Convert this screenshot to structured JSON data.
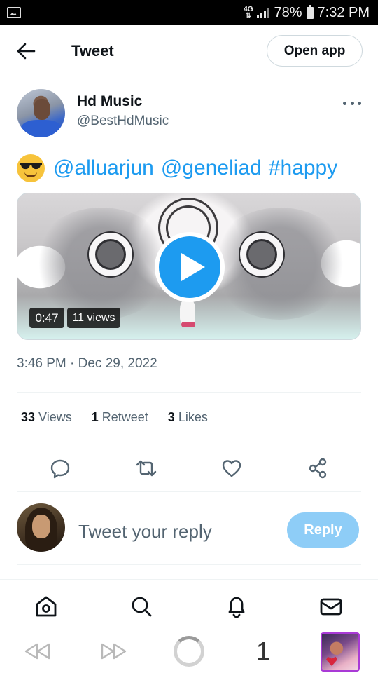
{
  "status_bar": {
    "network": "4G",
    "battery": "78%",
    "time": "7:32 PM"
  },
  "header": {
    "title": "Tweet",
    "open_app_label": "Open app"
  },
  "tweet": {
    "author_name": "Hd Music",
    "author_handle": "@BestHdMusic",
    "emoji": "sunglasses-emoji",
    "mentions": [
      "@alluarjun",
      "@geneliad",
      "#happy"
    ],
    "video": {
      "duration": "0:47",
      "views": "11 views"
    },
    "timestamp": "3:46 PM · Dec 29, 2022"
  },
  "stats": [
    {
      "count": "33",
      "label": "Views"
    },
    {
      "count": "1",
      "label": "Retweet"
    },
    {
      "count": "3",
      "label": "Likes"
    }
  ],
  "actions": [
    "reply-icon",
    "retweet-icon",
    "like-icon",
    "share-icon"
  ],
  "reply": {
    "placeholder": "Tweet your reply",
    "button_label": "Reply"
  },
  "tabbar": [
    "home-icon",
    "search-icon",
    "notifications-icon",
    "messages-icon"
  ],
  "browser": {
    "tab_count": "1"
  },
  "colors": {
    "accent": "#1d9bf0",
    "reply_button_disabled": "#8ecdf7",
    "secondary_text": "#536471",
    "profile_border": "#a93ad6"
  }
}
